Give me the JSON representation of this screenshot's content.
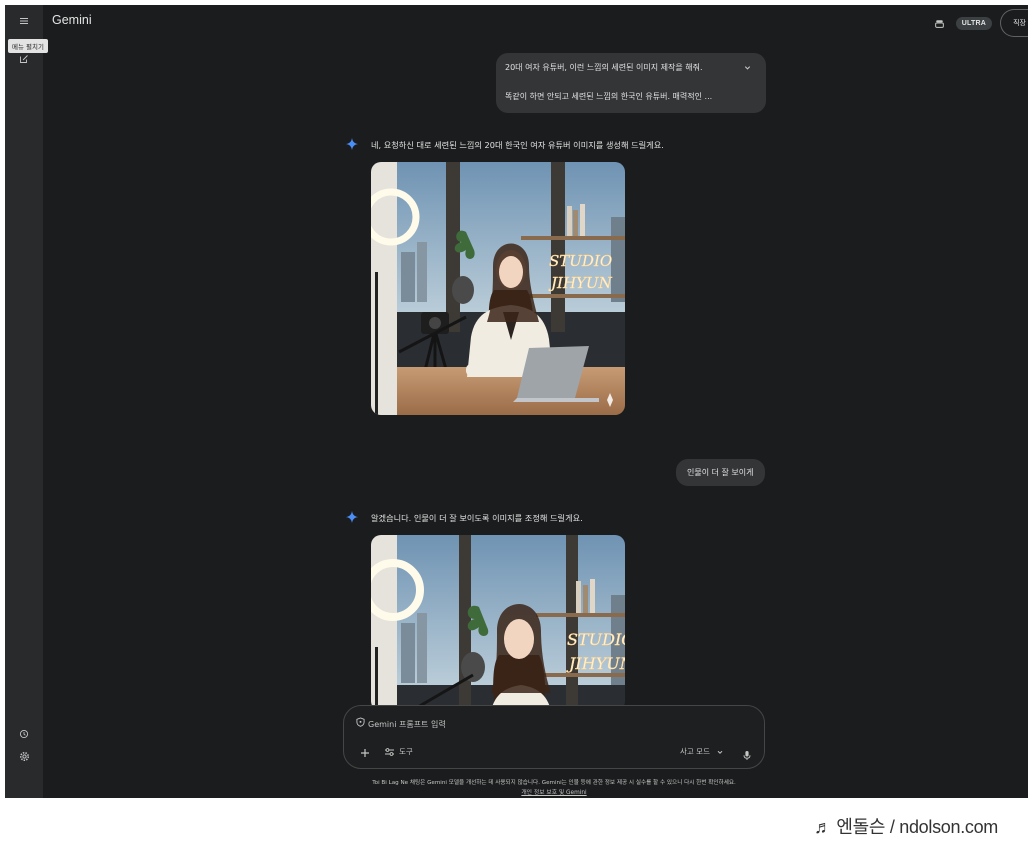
{
  "app": {
    "title": "Gemini",
    "plan_badge": "ULTRA",
    "work_label": "직장"
  },
  "sidebar": {
    "tooltip": "메뉴 펼치기"
  },
  "conversation": {
    "user_msg_1": {
      "line1": "20대 여자 유튜버, 이런 느낌의 세련된 이미지 제작을 해줘.",
      "line2": "똑같이 하면 안되고 세련된 느낌의 한국인 유튜버. 매력적인 ..."
    },
    "response_1": {
      "text": "네, 요청하신 대로 세련된 느낌의 20대 한국인 여자 유튜버 이미지를 생성해 드릴게요."
    },
    "user_msg_2": {
      "text": "인물이 더 잘 보이게"
    },
    "response_2": {
      "text": "알겠습니다. 인물이 더 잘 보이도록 이미지를 조정해 드릴게요."
    },
    "image_sign": {
      "line1": "STUDIO",
      "line2": "JIHYUN"
    }
  },
  "composer": {
    "placeholder": "Gemini 프롬프트 입력",
    "tools_label": "도구",
    "mode_label": "사고 모드"
  },
  "footer": {
    "disclaimer": "Toi Bi Lag Ne 채팅은 Gemini 모델을 개선하는 데 사용되지 않습니다. Gemini는 인물 등에 관한 정보 제공 시 실수를 할 수 있으니 다시 한번 확인하세요.",
    "privacy_link": "개인 정보 보호 및 Gemini"
  },
  "watermark": "♬ 엔돌슨 / ndolson.com",
  "colors": {
    "background": "#1b1c1d",
    "sidebar": "#282a2c",
    "bubble": "#333537",
    "accent": "#4c8df6"
  }
}
